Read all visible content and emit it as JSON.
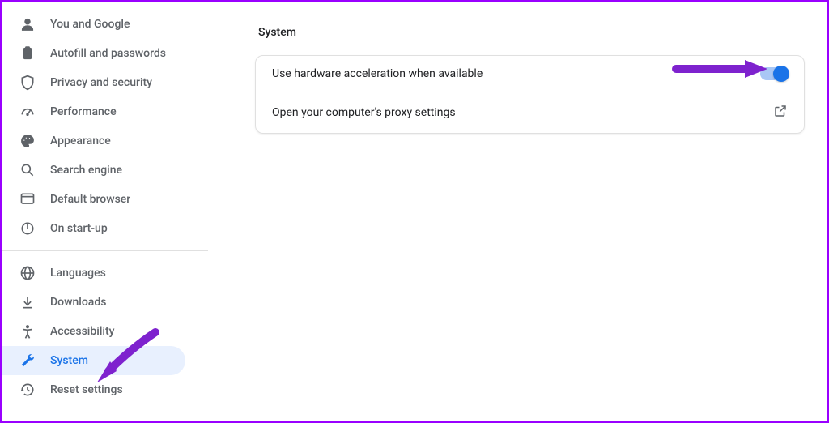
{
  "sidebar": {
    "group1": [
      {
        "label": "You and Google"
      },
      {
        "label": "Autofill and passwords"
      },
      {
        "label": "Privacy and security"
      },
      {
        "label": "Performance"
      },
      {
        "label": "Appearance"
      },
      {
        "label": "Search engine"
      },
      {
        "label": "Default browser"
      },
      {
        "label": "On start-up"
      }
    ],
    "group2": [
      {
        "label": "Languages"
      },
      {
        "label": "Downloads"
      },
      {
        "label": "Accessibility"
      },
      {
        "label": "System"
      },
      {
        "label": "Reset settings"
      }
    ],
    "selected": "System"
  },
  "main": {
    "title": "System",
    "rows": {
      "hw_accel": "Use hardware acceleration when available",
      "proxy": "Open your computer's proxy settings"
    },
    "hw_accel_enabled": true
  },
  "colors": {
    "accent": "#1a73e8",
    "highlight_arrow": "#7e22ce"
  }
}
